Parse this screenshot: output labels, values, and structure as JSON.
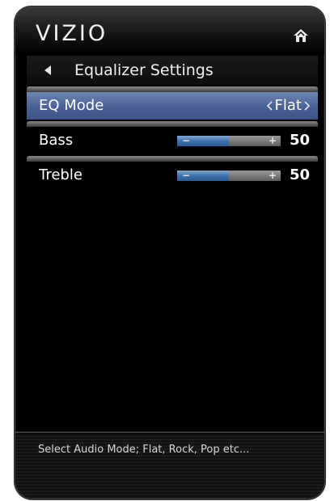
{
  "header": {
    "brand": "VIZIO",
    "home_icon": "home-icon"
  },
  "menu": {
    "title": "Equalizer Settings",
    "back_icon": "back-arrow-icon",
    "items": [
      {
        "label": "EQ Mode",
        "value": "Flat",
        "type": "selector",
        "selected": true
      },
      {
        "label": "Bass",
        "value": "50",
        "type": "slider",
        "level": 0.5
      },
      {
        "label": "Treble",
        "value": "50",
        "type": "slider",
        "level": 0.5
      }
    ]
  },
  "help": {
    "text": "Select Audio Mode; Flat, Rock, Pop etc..."
  },
  "colors": {
    "selected_row": "#4c6497",
    "slider_fill": "#3c6ea8"
  }
}
